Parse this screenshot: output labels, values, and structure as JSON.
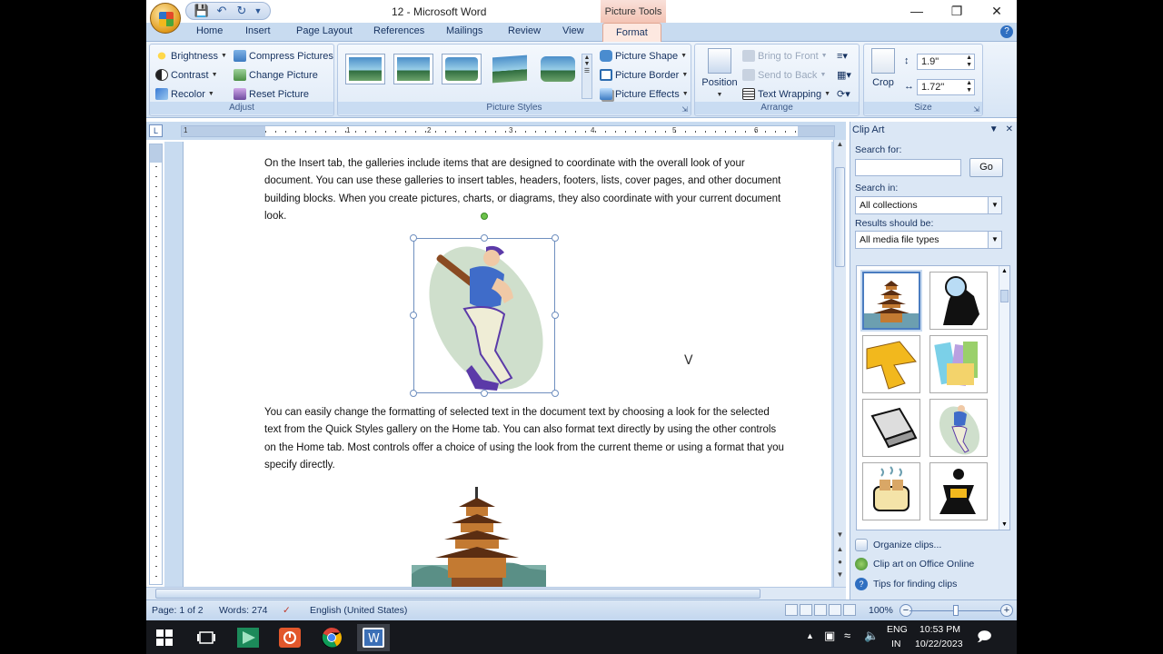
{
  "window": {
    "title": "12 - Microsoft Word",
    "context_tab_header": "Picture Tools"
  },
  "tabs": [
    "Home",
    "Insert",
    "Page Layout",
    "References",
    "Mailings",
    "Review",
    "View",
    "Format"
  ],
  "ribbon": {
    "adjust": {
      "label": "Adjust",
      "brightness": "Brightness",
      "contrast": "Contrast",
      "recolor": "Recolor",
      "compress": "Compress Pictures",
      "change": "Change Picture",
      "reset": "Reset Picture"
    },
    "styles": {
      "label": "Picture Styles",
      "shape": "Picture Shape",
      "border": "Picture Border",
      "effects": "Picture Effects"
    },
    "arrange": {
      "label": "Arrange",
      "position": "Position",
      "bring_front": "Bring to Front",
      "send_back": "Send to Back",
      "wrapping": "Text Wrapping"
    },
    "size": {
      "label": "Size",
      "crop": "Crop",
      "height": "1.9\"",
      "width": "1.72\""
    }
  },
  "ruler_numbers": [
    "1",
    "1",
    "2",
    "3",
    "4",
    "5",
    "6"
  ],
  "document": {
    "para1": "On the Insert tab, the galleries include items that are designed to coordinate with the overall look of your document. You can use these galleries to insert tables, headers, footers, lists, cover pages, and other document building blocks. When you create pictures, charts, or diagrams, they also coordinate with your current document look.",
    "para2": "You can easily change the formatting of selected text in the document text by choosing a look for the selected text from the Quick Styles gallery on the Home tab. You can also format text directly by using the other controls on the Home tab. Most controls offer a choice of using the look from the current theme or using a  format that you specify directly."
  },
  "clipart": {
    "title": "Clip Art",
    "search_for": "Search for:",
    "go": "Go",
    "search_in": "Search in:",
    "collections": "All collections",
    "results_be": "Results should be:",
    "media_types": "All media file types",
    "organize": "Organize clips...",
    "online": "Clip art on Office Online",
    "tips": "Tips for finding clips"
  },
  "status": {
    "page": "Page: 1 of 2",
    "words": "Words: 274",
    "language": "English (United States)",
    "zoom": "100%"
  },
  "taskbar": {
    "lang1": "ENG",
    "lang2": "IN",
    "time": "10:53 PM",
    "date": "10/22/2023"
  }
}
